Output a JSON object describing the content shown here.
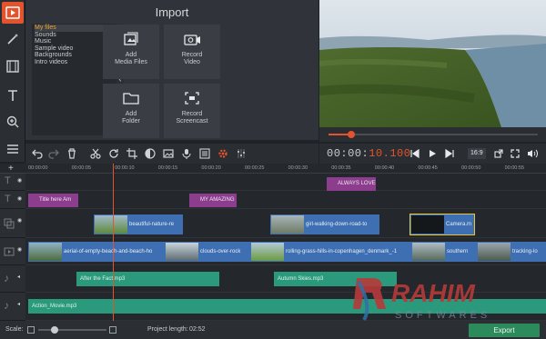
{
  "colors": {
    "accent": "#e2542e",
    "title_clip": "#8c3d8e",
    "video_clip": "#3d6fb2",
    "audio_clip": "#2b9a7c",
    "export": "#2c8b5b"
  },
  "rail": {
    "icons": [
      "film-import-icon",
      "magic-wand-icon",
      "filmstrip-icon",
      "text-icon",
      "zoom-icon",
      "list-menu-icon"
    ]
  },
  "import": {
    "title": "Import",
    "categories": [
      "My files",
      "Sounds",
      "Music",
      "Sample video",
      "Backgrounds",
      "Intro videos"
    ],
    "tiles": [
      {
        "label": "Add\nMedia Files",
        "icon": "media-files-icon"
      },
      {
        "label": "Record\nVideo",
        "icon": "camera-icon"
      },
      {
        "label": "Add\nFolder",
        "icon": "folder-icon"
      },
      {
        "label": "Record\nScreencast",
        "icon": "screencast-icon"
      }
    ]
  },
  "preview": {
    "progress": 0.11
  },
  "playback": {
    "timecode_a": "00:00:",
    "timecode_b": "10.100",
    "ratio": "16:9"
  },
  "ruler": {
    "ticks": [
      "00:00:00",
      "00:00:05",
      "00:00:10",
      "00:00:15",
      "00:00:20",
      "00:00:25",
      "00:00:30",
      "00:00:35",
      "00:00:40",
      "00:00:45",
      "00:00:50",
      "00:00:55"
    ]
  },
  "timeline": {
    "title_clips_top": [
      "ALWAYS LOVE"
    ],
    "title_clips": [
      "Title here Am",
      "MY AMAZING"
    ],
    "overlay_clips": [
      "beautiful-nature-re",
      "girl-walking-down-road-to",
      "Camera.m"
    ],
    "main_clips": [
      "aerial-of-empty-beach-and-beach-ho",
      "clouds-over-rock",
      "rolling-grass-hills-in-copenhagen_denmark_-1",
      "southern",
      "tracking-lo"
    ],
    "audio_clips": [
      "After the Fact.mp3",
      "Autumn Skies.mp3"
    ],
    "music_clips": [
      "Action_Movie.mp3"
    ]
  },
  "bottom": {
    "scale_label": "Scale:",
    "project_length_label": "Project length:",
    "project_length": "02:52",
    "export_label": "Export"
  },
  "watermark": {
    "text": "RAHIM",
    "subtext": "SOFTWARES"
  }
}
